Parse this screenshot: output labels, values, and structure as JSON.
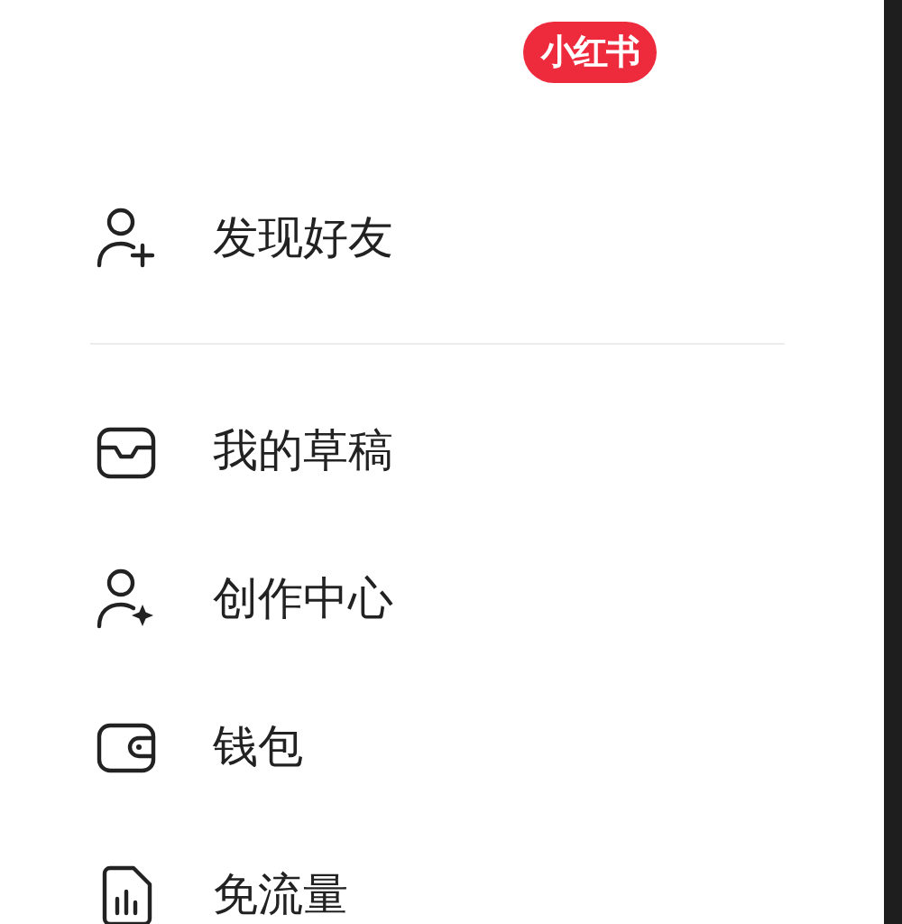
{
  "logo": "小红书",
  "sections": [
    {
      "items": [
        {
          "kind": "add-user",
          "label": "发现好友"
        }
      ]
    },
    {
      "items": [
        {
          "kind": "drafts",
          "label": "我的草稿"
        },
        {
          "kind": "creator",
          "label": "创作中心"
        },
        {
          "kind": "wallet",
          "label": "钱包"
        },
        {
          "kind": "data-card",
          "label": "免流量"
        }
      ]
    }
  ]
}
